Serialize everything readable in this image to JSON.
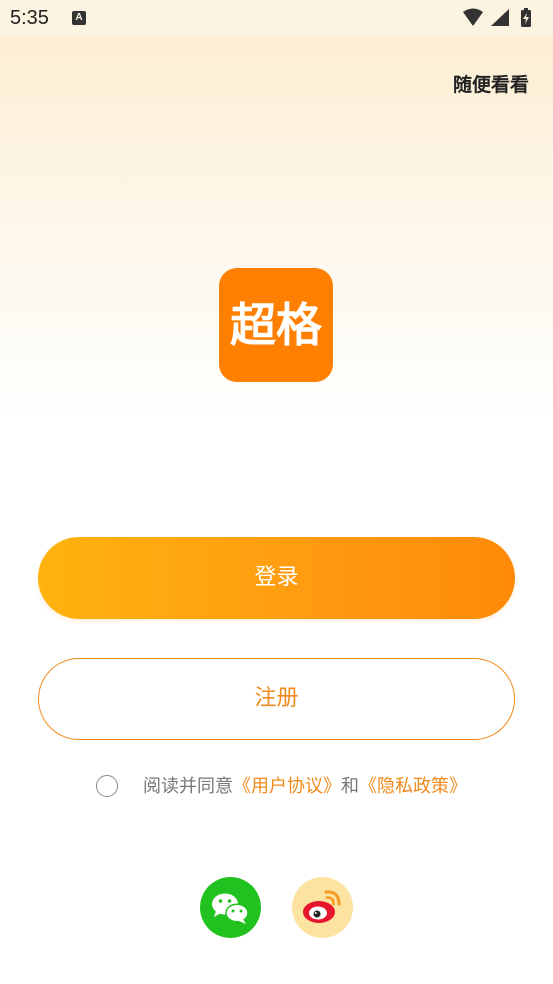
{
  "status_bar": {
    "time": "5:35",
    "notification_letter": "A"
  },
  "header": {
    "skip_label": "随便看看"
  },
  "logo": {
    "text": "超格"
  },
  "actions": {
    "login_label": "登录",
    "register_label": "注册"
  },
  "agreement": {
    "prefix": "阅读并同意",
    "user_agreement": "《用户协议》",
    "conjunction": "和",
    "privacy_policy": "《隐私政策》"
  },
  "social": {
    "wechat_icon": "wechat-icon",
    "weibo_icon": "weibo-icon"
  },
  "colors": {
    "brand_orange": "#ff7f00",
    "link_orange": "#f08a1c",
    "wechat_green": "#21c21f"
  }
}
